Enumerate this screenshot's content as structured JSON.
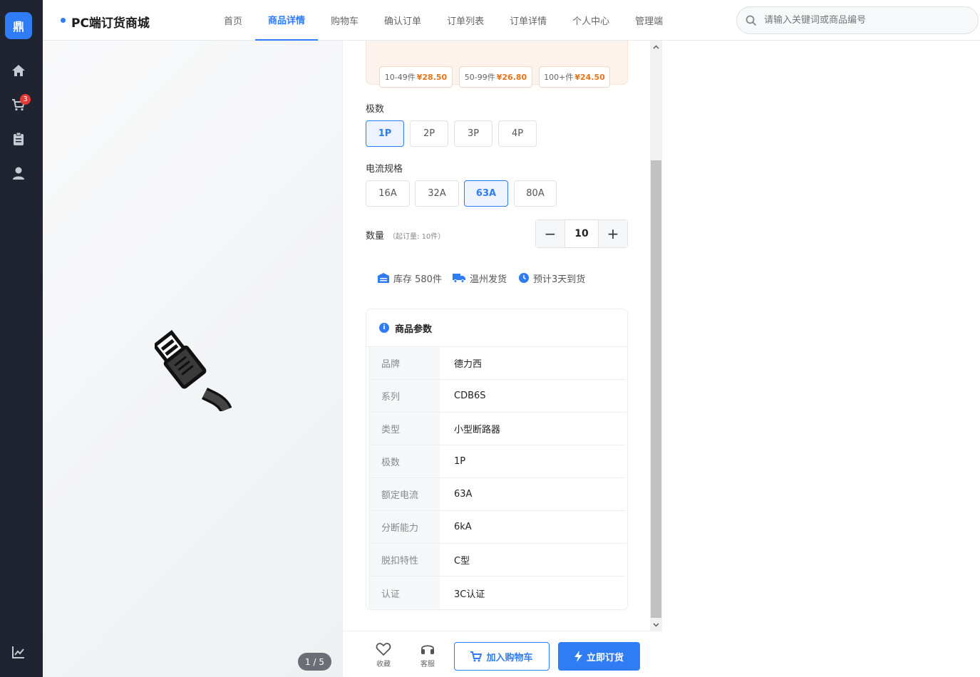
{
  "app": {
    "logo_text": "鼎",
    "brand": "PC端订货商城"
  },
  "rail": {
    "cart_badge": "3",
    "icons": [
      "home-icon",
      "cart-icon",
      "clipboard-icon",
      "user-icon",
      "chart-icon"
    ]
  },
  "nav": {
    "items": [
      "首页",
      "商品详情",
      "购物车",
      "确认订单",
      "订单列表",
      "订单详情",
      "个人中心",
      "管理端"
    ],
    "active_index": 1
  },
  "search": {
    "placeholder": "请输入关键词或商品编号"
  },
  "gallery": {
    "pager": "1 / 5"
  },
  "tiers": [
    {
      "range": "10-49件",
      "price": "¥28.50"
    },
    {
      "range": "50-99件",
      "price": "¥26.80"
    },
    {
      "range": "100+件",
      "price": "¥24.50"
    }
  ],
  "poles": {
    "label": "极数",
    "options": [
      "1P",
      "2P",
      "3P",
      "4P"
    ],
    "selected": "1P"
  },
  "current": {
    "label": "电流规格",
    "options": [
      "16A",
      "32A",
      "63A",
      "80A"
    ],
    "selected": "63A"
  },
  "quantity": {
    "label": "数量",
    "hint": "（起订量: 10件）",
    "value": "10",
    "minus": "−",
    "plus": "+"
  },
  "info": {
    "stock": "库存 580件",
    "ship_from": "温州发货",
    "eta": "预计3天到货"
  },
  "params": {
    "title": "商品参数",
    "rows": [
      {
        "k": "品牌",
        "v": "德力西"
      },
      {
        "k": "系列",
        "v": "CDB6S"
      },
      {
        "k": "类型",
        "v": "小型断路器"
      },
      {
        "k": "极数",
        "v": "1P"
      },
      {
        "k": "额定电流",
        "v": "63A"
      },
      {
        "k": "分断能力",
        "v": "6kA"
      },
      {
        "k": "脱扣特性",
        "v": "C型"
      },
      {
        "k": "认证",
        "v": "3C认证"
      }
    ]
  },
  "actions": {
    "favorite": "收藏",
    "service": "客服",
    "add_cart": "加入购物车",
    "order_now": "立即订货"
  },
  "colors": {
    "accent": "#2f7cf6",
    "price": "#e8741a",
    "rail": "#1f2430",
    "badge": "#e53935"
  }
}
